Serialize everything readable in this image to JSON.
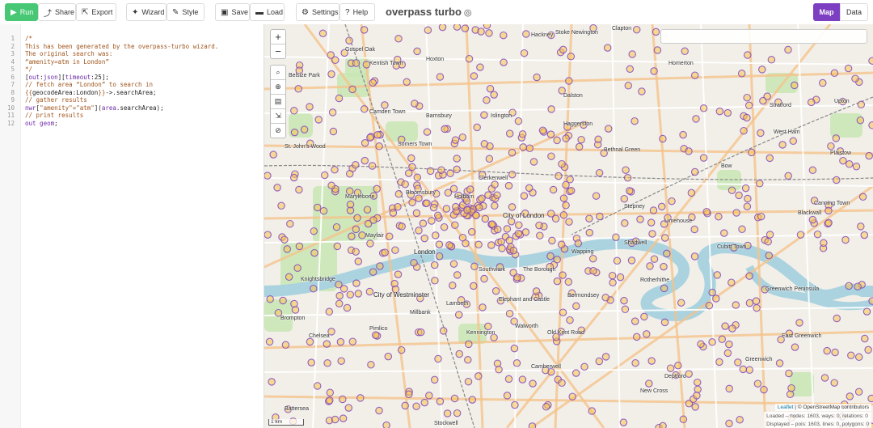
{
  "toolbar": {
    "run_label": "Run",
    "share_label": "Share",
    "export_label": "Export",
    "wizard_label": "Wizard",
    "style_label": "Style",
    "save_label": "Save",
    "load_label": "Load",
    "settings_label": "Settings",
    "help_label": "Help",
    "app_title": "overpass turbo",
    "map_label": "Map",
    "data_label": "Data"
  },
  "editor": {
    "lines": [
      {
        "n": "1",
        "parts": [
          [
            "c",
            "/*"
          ]
        ]
      },
      {
        "n": "2",
        "parts": [
          [
            "c",
            "This has been generated by the overpass-turbo wizard."
          ]
        ]
      },
      {
        "n": "3",
        "parts": [
          [
            "c",
            "The original search was:"
          ]
        ]
      },
      {
        "n": "4",
        "parts": [
          [
            "c",
            "“amenity=atm in London”"
          ]
        ]
      },
      {
        "n": "5",
        "parts": [
          [
            "c",
            "*/"
          ]
        ]
      },
      {
        "n": "6",
        "parts": [
          [
            "p",
            "["
          ],
          [
            "k",
            "out"
          ],
          [
            "p",
            ":"
          ],
          [
            "k",
            "json"
          ],
          [
            "p",
            "]["
          ],
          [
            "k",
            "timeout"
          ],
          [
            "p",
            ":25];"
          ]
        ]
      },
      {
        "n": "7",
        "parts": [
          [
            "c",
            "// fetch area “London” to search in"
          ]
        ]
      },
      {
        "n": "8",
        "parts": [
          [
            "c",
            "{{"
          ],
          [
            "p",
            "geocodeArea:London"
          ],
          [
            "c",
            "}}"
          ],
          [
            "p",
            "->.searchArea;"
          ]
        ]
      },
      {
        "n": "9",
        "parts": [
          [
            "c",
            "// gather results"
          ]
        ]
      },
      {
        "n": "10",
        "parts": [
          [
            "k",
            "nwr"
          ],
          [
            "p",
            "["
          ],
          [
            "c",
            "\"amenity\"=\"atm\""
          ],
          [
            "p",
            "]("
          ],
          [
            "k",
            "area"
          ],
          [
            "p",
            ".searchArea);"
          ]
        ]
      },
      {
        "n": "11",
        "parts": [
          [
            "c",
            "// print results"
          ]
        ]
      },
      {
        "n": "12",
        "parts": [
          [
            "k",
            "out geom"
          ],
          [
            "p",
            ";"
          ]
        ]
      }
    ]
  },
  "map": {
    "search_placeholder": "",
    "attribution_leaflet": "Leaflet",
    "attribution_osm": "| © OpenStreetMap contributors",
    "stats_loaded": "Loaded – nodes: 1603, ways: 0, relations: 0",
    "stats_displayed": "Displayed – pois: 1603, lines: 0, polygons: 0",
    "scale_label": "1 km",
    "place_labels": [
      "Kentish Town",
      "Camden Town",
      "Barnsbury",
      "Islington",
      "Dalston",
      "Haggerston",
      "Somers Town",
      "St. John's Wood",
      "Bloomsbury",
      "Clerkenwell",
      "Marylebone",
      "Holborn",
      "City of London",
      "Mayfair",
      "London",
      "Knightsbridge",
      "City of Westminster",
      "Southwark",
      "Bermondsey",
      "Wapping",
      "Shadwell",
      "Rotherhithe",
      "Lambeth",
      "Kennington",
      "Walworth",
      "Old Kent Road",
      "Millbank",
      "Pimlico",
      "Chelsea",
      "Brompton",
      "Battersea",
      "Bethnal Green",
      "Stepney",
      "Limehouse",
      "Bow",
      "Stratford",
      "West Ham",
      "Plaistow",
      "Canning Town",
      "Greenwich Peninsula",
      "East Greenwich",
      "Greenwich",
      "New Cross",
      "Deptford",
      "Hoxton",
      "Hackney",
      "Stoke Newington",
      "Belsize Park",
      "Gospel Oak",
      "Elephant and Castle",
      "Camberwell",
      "The Borough",
      "Stockwell",
      "Clapton",
      "Homerton",
      "Upton",
      "Cubitt Town",
      "Blackwall"
    ],
    "colors": {
      "poi_stroke": "#7b3fc0",
      "poi_fill": "#f7c44f",
      "water": "#aad3df",
      "park": "#c8e6b4",
      "background": "#f2efe9"
    }
  }
}
